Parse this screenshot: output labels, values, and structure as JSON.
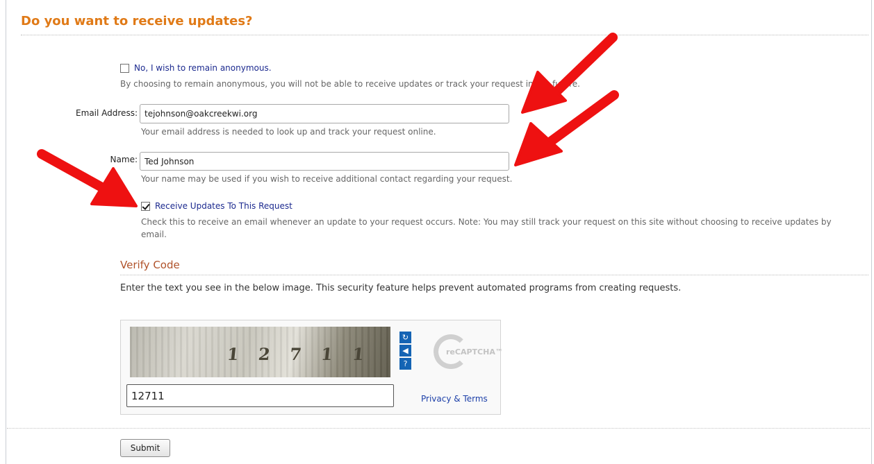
{
  "section": {
    "title": "Do you want to receive updates?"
  },
  "anonymous": {
    "label": "No, I wish to remain anonymous.",
    "checked": false,
    "help": "By choosing to remain anonymous, you will not be able to receive updates or track your request in the future."
  },
  "email": {
    "label": "Email Address:",
    "value": "tejohnson@oakcreekwi.org",
    "help": "Your email address is needed to look up and track your request online."
  },
  "name": {
    "label": "Name:",
    "value": "Ted Johnson",
    "help": "Your name may be used if you wish to receive additional contact regarding your request."
  },
  "updates": {
    "label": "Receive Updates To This Request",
    "checked": true,
    "help": "Check this to receive an email whenever an update to your request occurs. Note: You may still track your request on this site without choosing to receive updates by email."
  },
  "verify": {
    "title": "Verify Code",
    "intro": "Enter the text you see in the below image. This security feature helps prevent automated programs from creating requests."
  },
  "captcha": {
    "image_text": "1 2 7 1 1",
    "input_value": "12711",
    "privacy_link": "Privacy & Terms",
    "logo_text": "reCAPTCHA™"
  },
  "submit": {
    "label": "Submit"
  },
  "colors": {
    "title": "#e07a17",
    "subtitle": "#b0522a",
    "link": "#1c2a8f",
    "arrow": "#ee1111"
  }
}
